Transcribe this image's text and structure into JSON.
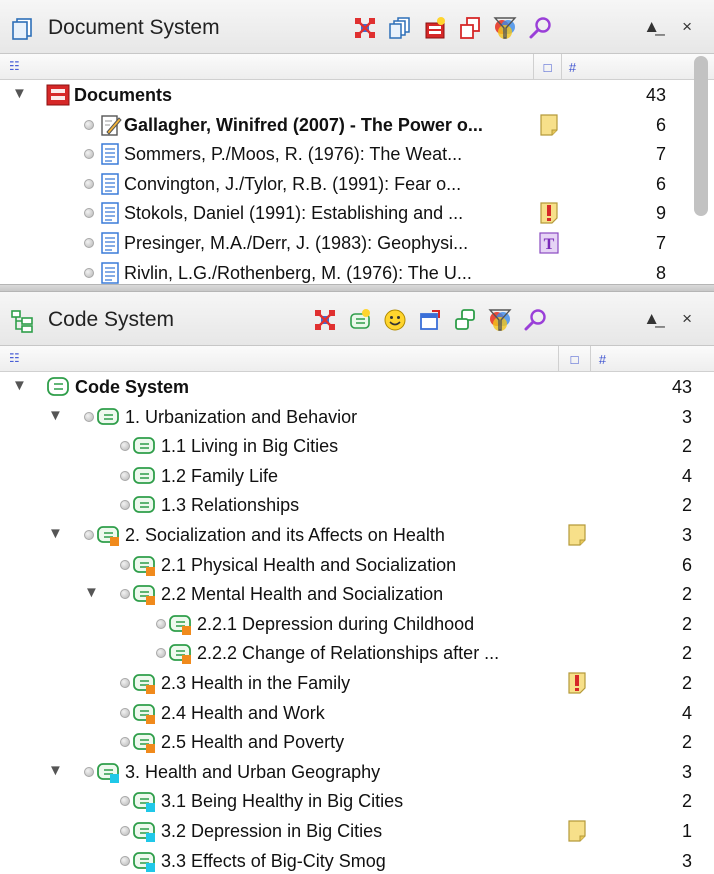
{
  "document_system": {
    "title": "Document System",
    "toolbar_icons": [
      "reset-activations-icon",
      "copy-docs-icon",
      "new-doc-icon",
      "duplicate-icon",
      "filter-icon",
      "search-icon"
    ],
    "window_buttons": {
      "collapse": "▲̲",
      "close": "×"
    },
    "col_header_icon": "☷",
    "col_color": "□",
    "col_count": "#",
    "root": {
      "label": "Documents",
      "count": "43"
    },
    "items": [
      {
        "label": "Gallagher, Winifred (2007) - The Power o...",
        "count": "6",
        "bold": true,
        "memo": "yellow",
        "icon": "edit-doc-icon"
      },
      {
        "label": "Sommers, P./Moos, R. (1976): The Weat...",
        "count": "7",
        "memo": "",
        "icon": "text-doc-icon"
      },
      {
        "label": "Convington, J./Tylor, R.B. (1991): Fear o...",
        "count": "6",
        "memo": "",
        "icon": "text-doc-icon"
      },
      {
        "label": "Stokols, Daniel (1991): Establishing and ...",
        "count": "9",
        "memo": "exclaim",
        "icon": "text-doc-icon"
      },
      {
        "label": "Presinger, M.A./Derr, J. (1983): Geophysi...",
        "count": "7",
        "memo": "T",
        "icon": "text-doc-icon"
      },
      {
        "label": "Rivlin, L.G./Rothenberg, M. (1976): The U...",
        "count": "8",
        "memo": "",
        "icon": "text-doc-icon"
      }
    ]
  },
  "code_system": {
    "title": "Code System",
    "toolbar_icons": [
      "reset-activations-icon",
      "new-code-icon",
      "emoticode-icon",
      "export-icon",
      "link-icon",
      "filter-icon",
      "search-icon"
    ],
    "window_buttons": {
      "collapse": "▲̲",
      "close": "×"
    },
    "col_header_icon": "☷",
    "col_color": "□",
    "col_count": "#",
    "root": {
      "label": "Code System",
      "count": "43"
    },
    "codes": [
      {
        "label": "1. Urbanization and Behavior",
        "count": "3",
        "level": 1,
        "expanded": true,
        "color": "",
        "memo": ""
      },
      {
        "label": "1.1 Living in Big Cities",
        "count": "2",
        "level": 2,
        "color": "",
        "memo": ""
      },
      {
        "label": "1.2 Family Life",
        "count": "4",
        "level": 2,
        "color": "",
        "memo": ""
      },
      {
        "label": "1.3 Relationships",
        "count": "2",
        "level": 2,
        "color": "",
        "memo": ""
      },
      {
        "label": "2. Socialization and its Affects on Health",
        "count": "3",
        "level": 1,
        "expanded": true,
        "color": "#f08a1c",
        "memo": "yellow"
      },
      {
        "label": "2.1 Physical Health and Socialization",
        "count": "6",
        "level": 2,
        "color": "#f08a1c",
        "memo": ""
      },
      {
        "label": "2.2 Mental Health and Socialization",
        "count": "2",
        "level": 2,
        "expanded": true,
        "color": "#f08a1c",
        "memo": ""
      },
      {
        "label": "2.2.1 Depression during Childhood",
        "count": "2",
        "level": 3,
        "color": "#f08a1c",
        "memo": ""
      },
      {
        "label": "2.2.2 Change of Relationships after ...",
        "count": "2",
        "level": 3,
        "color": "#f08a1c",
        "memo": ""
      },
      {
        "label": "2.3 Health in the Family",
        "count": "2",
        "level": 2,
        "color": "#f08a1c",
        "memo": "exclaim"
      },
      {
        "label": "2.4 Health and Work",
        "count": "4",
        "level": 2,
        "color": "#f08a1c",
        "memo": ""
      },
      {
        "label": "2.5 Health and Poverty",
        "count": "2",
        "level": 2,
        "color": "#f08a1c",
        "memo": ""
      },
      {
        "label": "3. Health and Urban Geography",
        "count": "3",
        "level": 1,
        "expanded": true,
        "color": "#20c8e8",
        "memo": ""
      },
      {
        "label": "3.1 Being Healthy in Big Cities",
        "count": "2",
        "level": 2,
        "color": "#20c8e8",
        "memo": ""
      },
      {
        "label": "3.2 Depression in Big Cities",
        "count": "1",
        "level": 2,
        "color": "#20c8e8",
        "memo": "yellow"
      },
      {
        "label": "3.3 Effects of Big-City Smog",
        "count": "3",
        "level": 2,
        "color": "#20c8e8",
        "memo": ""
      }
    ]
  }
}
